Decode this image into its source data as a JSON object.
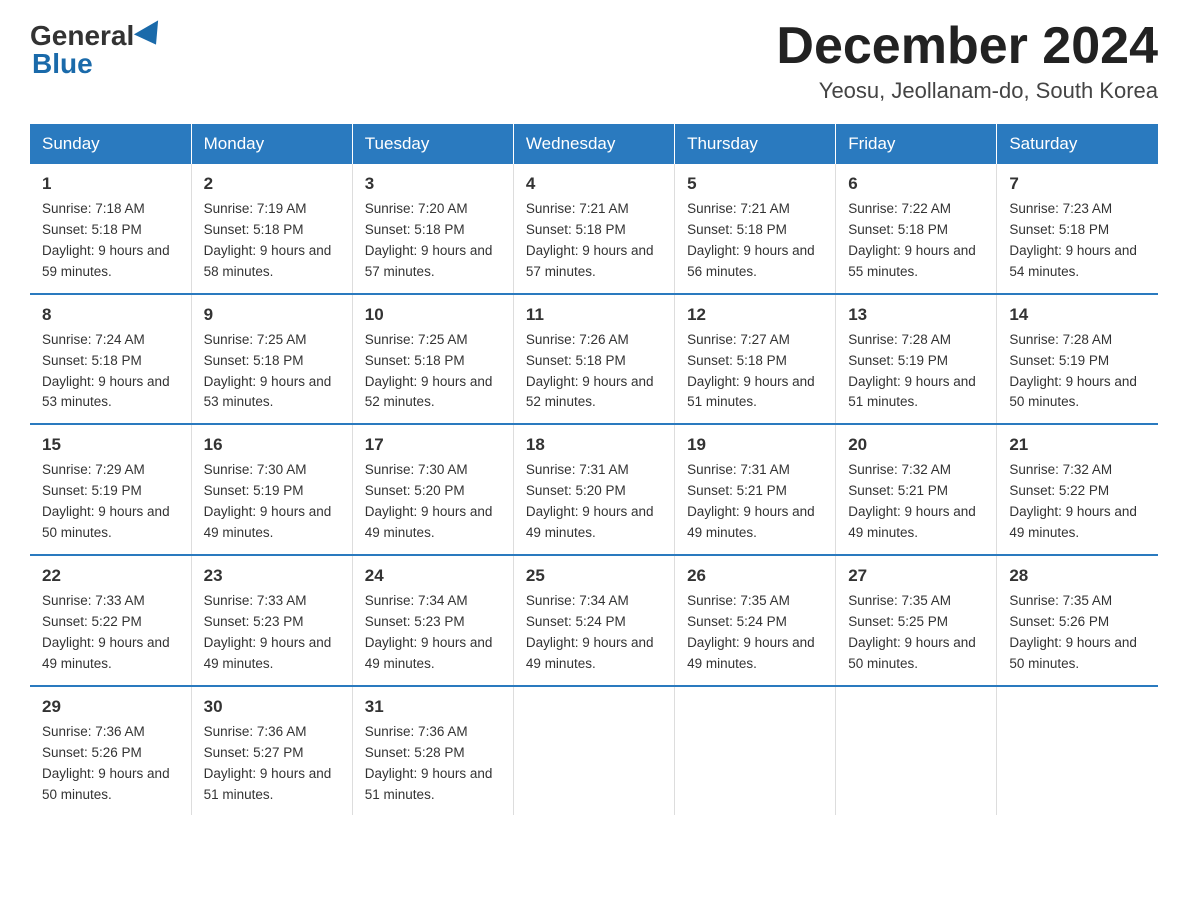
{
  "header": {
    "logo_general": "General",
    "logo_blue": "Blue",
    "month_title": "December 2024",
    "location": "Yeosu, Jeollanam-do, South Korea"
  },
  "days_of_week": [
    "Sunday",
    "Monday",
    "Tuesday",
    "Wednesday",
    "Thursday",
    "Friday",
    "Saturday"
  ],
  "weeks": [
    [
      {
        "day": "1",
        "sunrise": "7:18 AM",
        "sunset": "5:18 PM",
        "daylight": "9 hours and 59 minutes."
      },
      {
        "day": "2",
        "sunrise": "7:19 AM",
        "sunset": "5:18 PM",
        "daylight": "9 hours and 58 minutes."
      },
      {
        "day": "3",
        "sunrise": "7:20 AM",
        "sunset": "5:18 PM",
        "daylight": "9 hours and 57 minutes."
      },
      {
        "day": "4",
        "sunrise": "7:21 AM",
        "sunset": "5:18 PM",
        "daylight": "9 hours and 57 minutes."
      },
      {
        "day": "5",
        "sunrise": "7:21 AM",
        "sunset": "5:18 PM",
        "daylight": "9 hours and 56 minutes."
      },
      {
        "day": "6",
        "sunrise": "7:22 AM",
        "sunset": "5:18 PM",
        "daylight": "9 hours and 55 minutes."
      },
      {
        "day": "7",
        "sunrise": "7:23 AM",
        "sunset": "5:18 PM",
        "daylight": "9 hours and 54 minutes."
      }
    ],
    [
      {
        "day": "8",
        "sunrise": "7:24 AM",
        "sunset": "5:18 PM",
        "daylight": "9 hours and 53 minutes."
      },
      {
        "day": "9",
        "sunrise": "7:25 AM",
        "sunset": "5:18 PM",
        "daylight": "9 hours and 53 minutes."
      },
      {
        "day": "10",
        "sunrise": "7:25 AM",
        "sunset": "5:18 PM",
        "daylight": "9 hours and 52 minutes."
      },
      {
        "day": "11",
        "sunrise": "7:26 AM",
        "sunset": "5:18 PM",
        "daylight": "9 hours and 52 minutes."
      },
      {
        "day": "12",
        "sunrise": "7:27 AM",
        "sunset": "5:18 PM",
        "daylight": "9 hours and 51 minutes."
      },
      {
        "day": "13",
        "sunrise": "7:28 AM",
        "sunset": "5:19 PM",
        "daylight": "9 hours and 51 minutes."
      },
      {
        "day": "14",
        "sunrise": "7:28 AM",
        "sunset": "5:19 PM",
        "daylight": "9 hours and 50 minutes."
      }
    ],
    [
      {
        "day": "15",
        "sunrise": "7:29 AM",
        "sunset": "5:19 PM",
        "daylight": "9 hours and 50 minutes."
      },
      {
        "day": "16",
        "sunrise": "7:30 AM",
        "sunset": "5:19 PM",
        "daylight": "9 hours and 49 minutes."
      },
      {
        "day": "17",
        "sunrise": "7:30 AM",
        "sunset": "5:20 PM",
        "daylight": "9 hours and 49 minutes."
      },
      {
        "day": "18",
        "sunrise": "7:31 AM",
        "sunset": "5:20 PM",
        "daylight": "9 hours and 49 minutes."
      },
      {
        "day": "19",
        "sunrise": "7:31 AM",
        "sunset": "5:21 PM",
        "daylight": "9 hours and 49 minutes."
      },
      {
        "day": "20",
        "sunrise": "7:32 AM",
        "sunset": "5:21 PM",
        "daylight": "9 hours and 49 minutes."
      },
      {
        "day": "21",
        "sunrise": "7:32 AM",
        "sunset": "5:22 PM",
        "daylight": "9 hours and 49 minutes."
      }
    ],
    [
      {
        "day": "22",
        "sunrise": "7:33 AM",
        "sunset": "5:22 PM",
        "daylight": "9 hours and 49 minutes."
      },
      {
        "day": "23",
        "sunrise": "7:33 AM",
        "sunset": "5:23 PM",
        "daylight": "9 hours and 49 minutes."
      },
      {
        "day": "24",
        "sunrise": "7:34 AM",
        "sunset": "5:23 PM",
        "daylight": "9 hours and 49 minutes."
      },
      {
        "day": "25",
        "sunrise": "7:34 AM",
        "sunset": "5:24 PM",
        "daylight": "9 hours and 49 minutes."
      },
      {
        "day": "26",
        "sunrise": "7:35 AM",
        "sunset": "5:24 PM",
        "daylight": "9 hours and 49 minutes."
      },
      {
        "day": "27",
        "sunrise": "7:35 AM",
        "sunset": "5:25 PM",
        "daylight": "9 hours and 50 minutes."
      },
      {
        "day": "28",
        "sunrise": "7:35 AM",
        "sunset": "5:26 PM",
        "daylight": "9 hours and 50 minutes."
      }
    ],
    [
      {
        "day": "29",
        "sunrise": "7:36 AM",
        "sunset": "5:26 PM",
        "daylight": "9 hours and 50 minutes."
      },
      {
        "day": "30",
        "sunrise": "7:36 AM",
        "sunset": "5:27 PM",
        "daylight": "9 hours and 51 minutes."
      },
      {
        "day": "31",
        "sunrise": "7:36 AM",
        "sunset": "5:28 PM",
        "daylight": "9 hours and 51 minutes."
      },
      null,
      null,
      null,
      null
    ]
  ]
}
